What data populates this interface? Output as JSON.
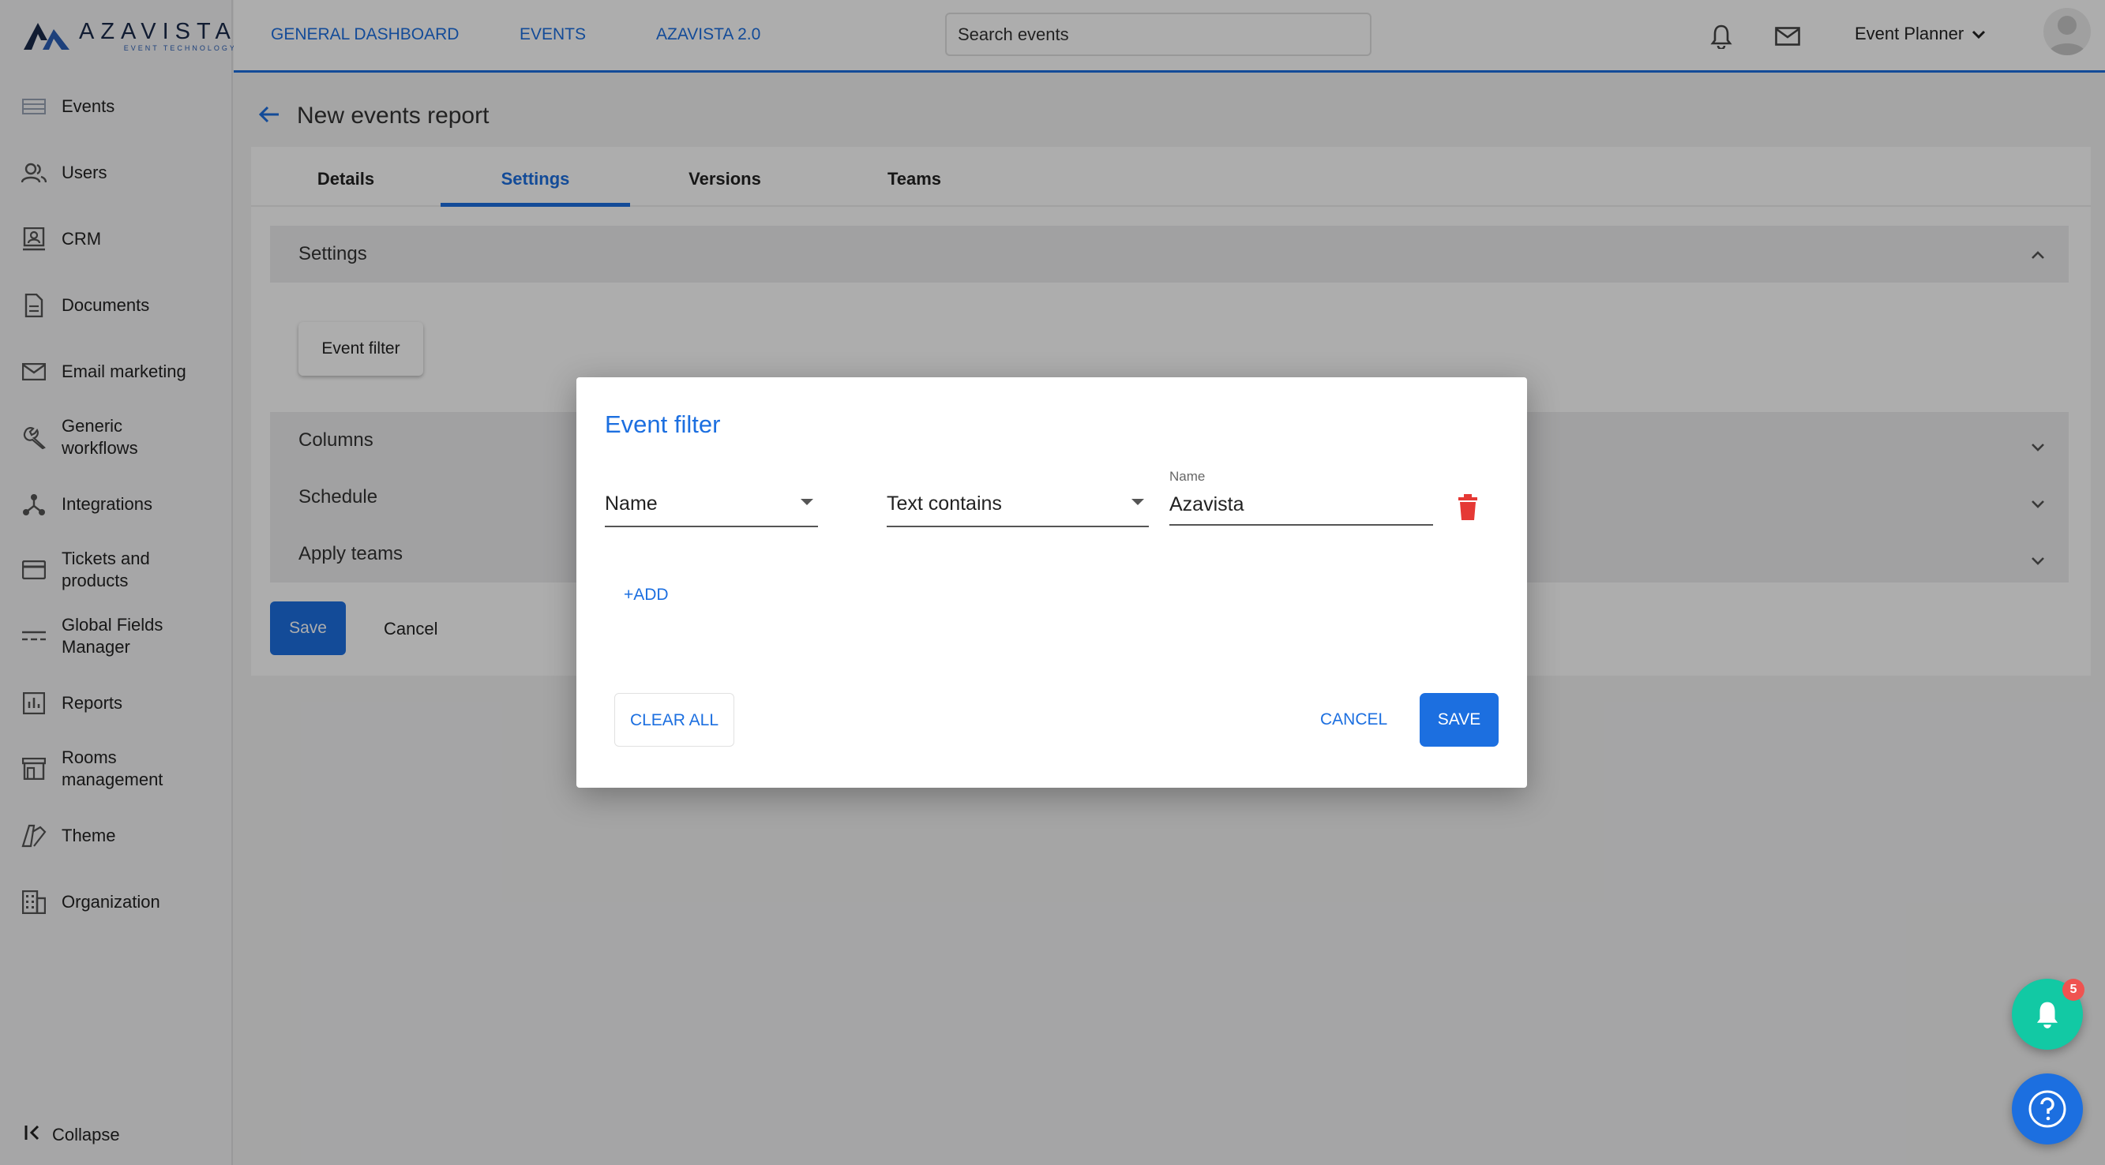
{
  "brand": {
    "name": "AZAVISTA",
    "tagline": "EVENT TECHNOLOGY"
  },
  "sidebar": {
    "items": [
      {
        "label": "Events",
        "icon": "events-icon"
      },
      {
        "label": "Users",
        "icon": "users-icon"
      },
      {
        "label": "CRM",
        "icon": "crm-icon"
      },
      {
        "label": "Documents",
        "icon": "document-icon"
      },
      {
        "label": "Email marketing",
        "icon": "mail-icon"
      },
      {
        "label": "Generic workflows",
        "icon": "wrench-icon"
      },
      {
        "label": "Integrations",
        "icon": "integrations-icon"
      },
      {
        "label": "Tickets and products",
        "icon": "card-icon"
      },
      {
        "label": "Global Fields Manager",
        "icon": "fields-icon"
      },
      {
        "label": "Reports",
        "icon": "reports-icon"
      },
      {
        "label": "Rooms management",
        "icon": "rooms-icon"
      },
      {
        "label": "Theme",
        "icon": "theme-icon"
      },
      {
        "label": "Organization",
        "icon": "organization-icon"
      }
    ],
    "collapse_label": "Collapse"
  },
  "topbar": {
    "links": [
      "GENERAL DASHBOARD",
      "EVENTS",
      "AZAVISTA 2.0"
    ],
    "search_placeholder": "Search events",
    "user_label": "Event Planner"
  },
  "page": {
    "title": "New events report",
    "tabs": [
      "Details",
      "Settings",
      "Versions",
      "Teams"
    ],
    "active_tab": "Settings",
    "sections": {
      "settings": "Settings",
      "columns": "Columns",
      "schedule": "Schedule",
      "apply_teams": "Apply teams"
    },
    "event_filter_button": "Event filter",
    "save_label": "Save",
    "cancel_label": "Cancel"
  },
  "modal": {
    "title": "Event filter",
    "field_select": "Name",
    "operator_select": "Text contains",
    "value_label": "Name",
    "value": "Azavista",
    "add_label": "+ADD",
    "clear_label": "CLEAR ALL",
    "cancel_label": "CANCEL",
    "save_label": "SAVE"
  },
  "notifications": {
    "count": "5"
  },
  "colors": {
    "accent": "#1c6fe0",
    "fab": "#12c9a4",
    "danger": "#e53935",
    "badge": "#ef5350"
  }
}
